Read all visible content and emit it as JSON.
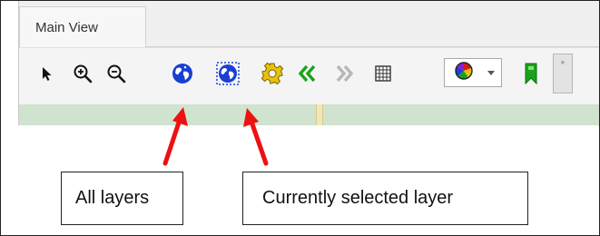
{
  "window": {
    "tab_label": "Main View"
  },
  "toolbar": {
    "tools": [
      {
        "name": "select-arrow-icon",
        "tooltip": ""
      },
      {
        "name": "zoom-in-icon",
        "tooltip": ""
      },
      {
        "name": "zoom-out-icon",
        "tooltip": ""
      },
      {
        "name": "globe-all-layers-icon",
        "tooltip": ""
      },
      {
        "name": "globe-selected-layer-icon",
        "tooltip": ""
      },
      {
        "name": "gear-icon",
        "tooltip": ""
      },
      {
        "name": "back-double-chevron-icon",
        "tooltip": ""
      },
      {
        "name": "forward-double-chevron-icon",
        "tooltip": ""
      },
      {
        "name": "grid-icon",
        "tooltip": ""
      },
      {
        "name": "color-picker-icon",
        "tooltip": ""
      },
      {
        "name": "bookmark-icon",
        "tooltip": ""
      }
    ],
    "small_box_label": "*"
  },
  "callouts": {
    "all_layers": "All layers",
    "currently_selected": "Currently selected layer"
  },
  "colors": {
    "annotation_arrow": "#ee1111",
    "globe_blue": "#1a3fd4",
    "gear_yellow": "#e8c20a",
    "chevron_green": "#1aa31a",
    "map_green": "#cfe3cf"
  }
}
